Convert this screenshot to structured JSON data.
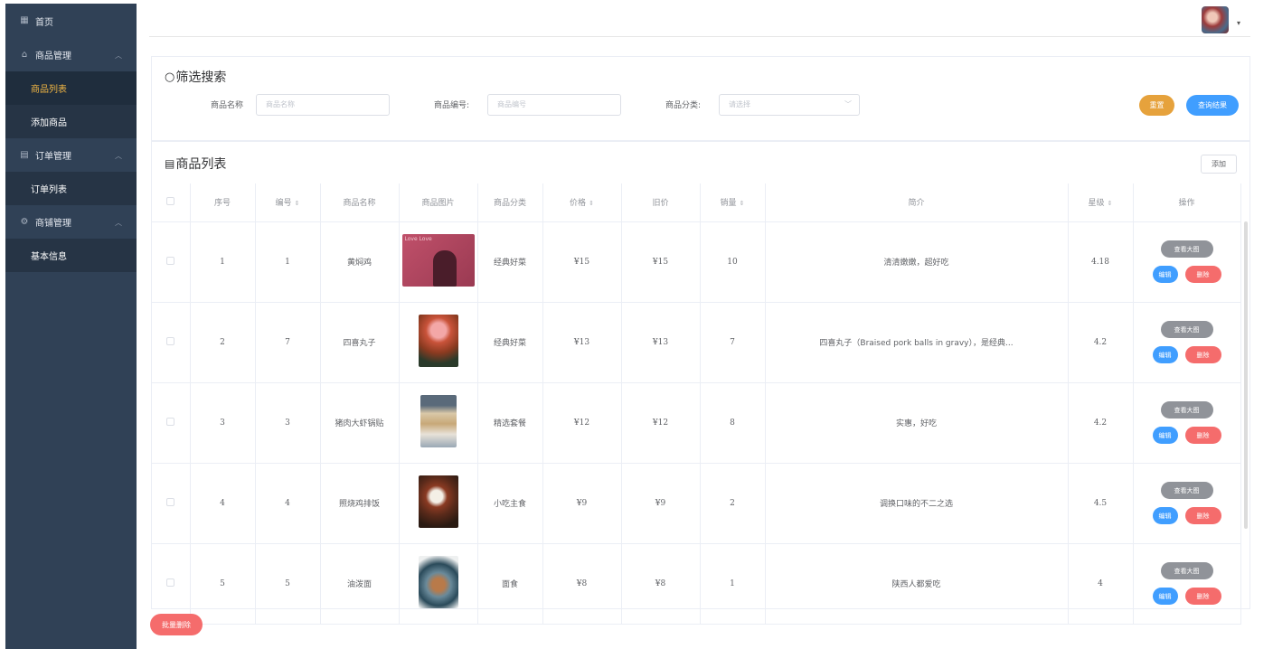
{
  "sidebar": {
    "home": "首页",
    "groups": [
      {
        "label": "商品管理",
        "items": [
          "商品列表",
          "添加商品"
        ]
      },
      {
        "label": "订单管理",
        "items": [
          "订单列表"
        ]
      },
      {
        "label": "商铺管理",
        "items": [
          "基本信息"
        ]
      }
    ],
    "active_item": "商品列表"
  },
  "filter": {
    "title": "筛选搜索",
    "name_label": "商品名称",
    "name_placeholder": "商品名称",
    "code_label": "商品编号:",
    "code_placeholder": "商品编号",
    "category_label": "商品分类:",
    "category_placeholder": "请选择",
    "reset_label": "重置",
    "query_label": "查询结果"
  },
  "list": {
    "title": "商品列表",
    "add_label": "添加",
    "columns": [
      "序号",
      "编号",
      "商品名称",
      "商品图片",
      "商品分类",
      "价格",
      "旧价",
      "销量",
      "简介",
      "星级",
      "操作"
    ],
    "view_label": "查看大图",
    "edit_label": "编辑",
    "delete_label": "删除",
    "rows": [
      {
        "index": "1",
        "code": "1",
        "name": "黄焖鸡",
        "category": "经典好菜",
        "price": "¥15",
        "old_price": "¥15",
        "sales": "10",
        "intro": "清清嫩嫩，超好吃",
        "stars": "4.18",
        "image_caption": "Love Love"
      },
      {
        "index": "2",
        "code": "7",
        "name": "四喜丸子",
        "category": "经典好菜",
        "price": "¥13",
        "old_price": "¥13",
        "sales": "7",
        "intro": "四喜丸子（Braised pork balls in gravy），是经典...",
        "stars": "4.2"
      },
      {
        "index": "3",
        "code": "3",
        "name": "猪肉大虾锅贴",
        "category": "精选套餐",
        "price": "¥12",
        "old_price": "¥12",
        "sales": "8",
        "intro": "实惠，好吃",
        "stars": "4.2"
      },
      {
        "index": "4",
        "code": "4",
        "name": "照烧鸡排饭",
        "category": "小吃主食",
        "price": "¥9",
        "old_price": "¥9",
        "sales": "2",
        "intro": "调换口味的不二之选",
        "stars": "4.5"
      },
      {
        "index": "5",
        "code": "5",
        "name": "油泼面",
        "category": "面食",
        "price": "¥8",
        "old_price": "¥8",
        "sales": "1",
        "intro": "陕西人都爱吃",
        "stars": "4"
      }
    ]
  },
  "batch_delete_label": "批量删除",
  "colors": {
    "sidebar": "#304156",
    "active": "#f0b544",
    "primary": "#409eff",
    "danger": "#f56c6c",
    "warning": "#e6a23c",
    "info": "#909399"
  }
}
